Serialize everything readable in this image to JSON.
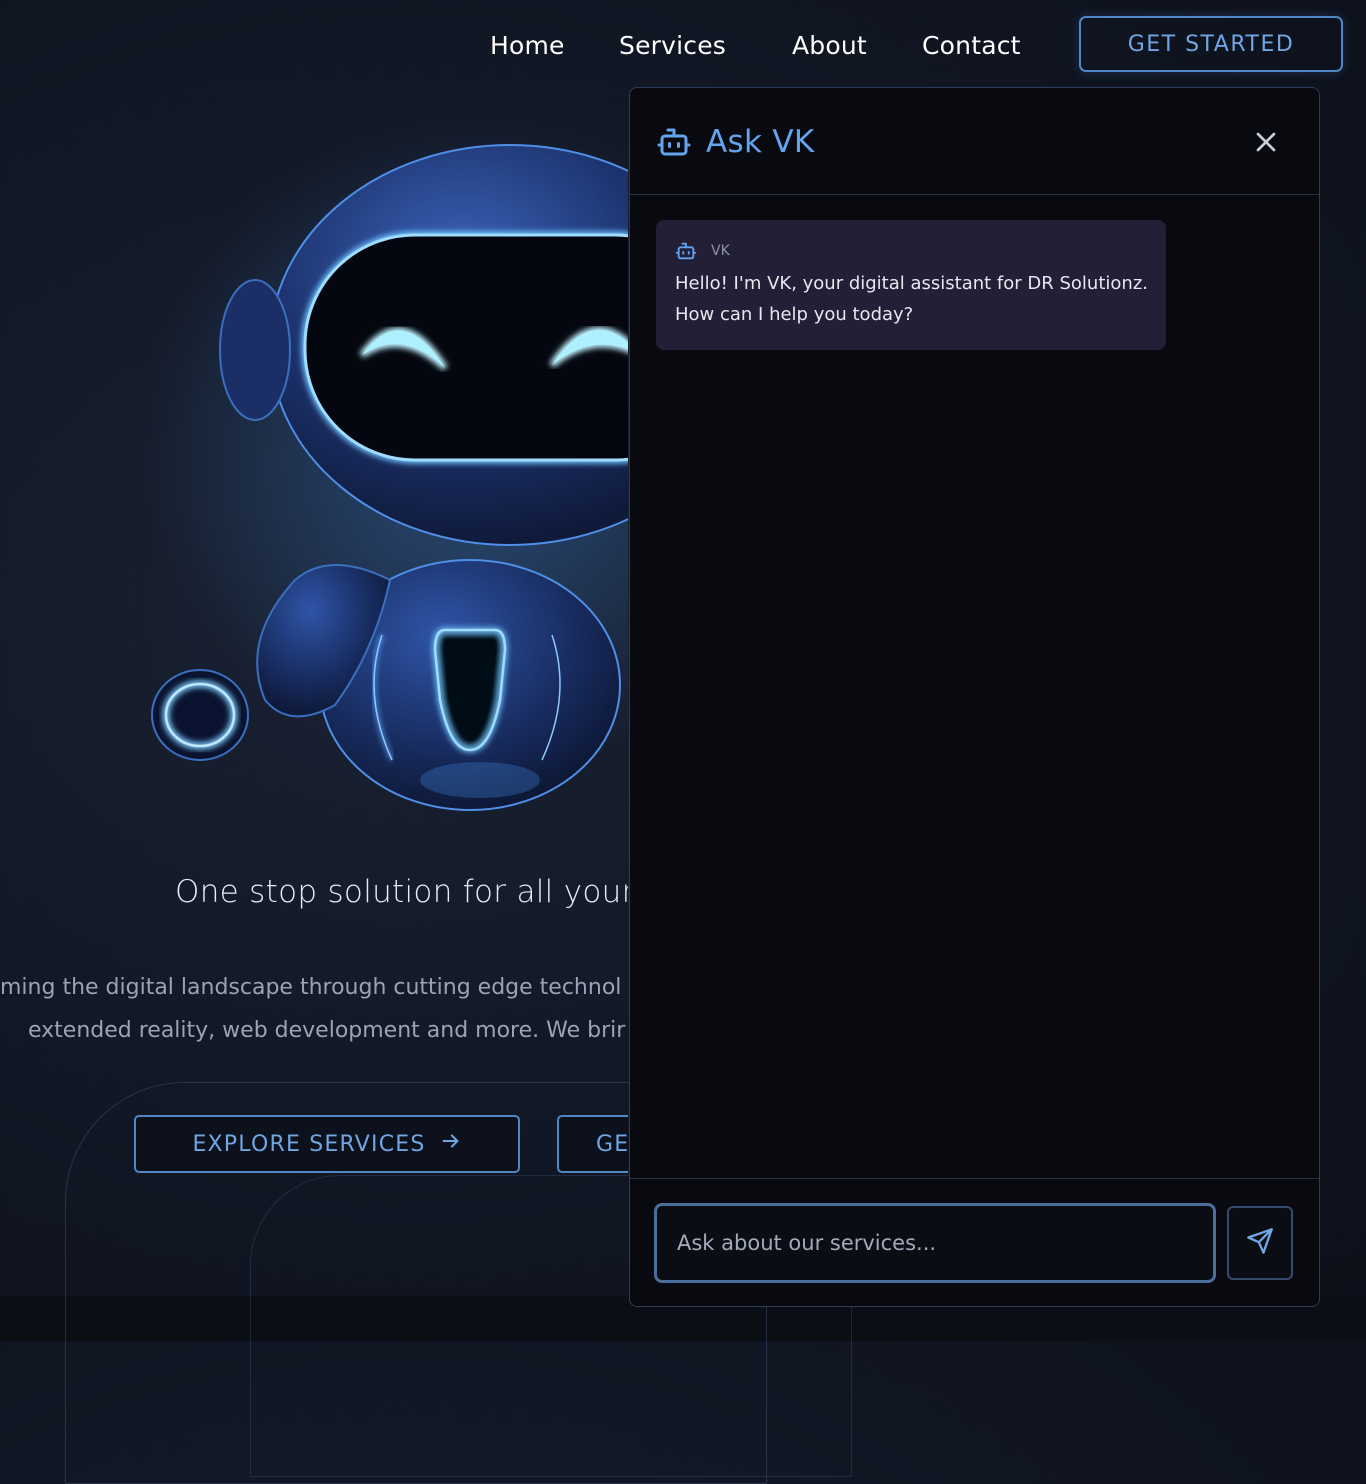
{
  "nav": {
    "links": [
      "Home",
      "Services",
      "About",
      "Contact"
    ],
    "cta_label": "GET STARTED"
  },
  "hero": {
    "headline": "One stop solution for all your D",
    "paragraph_line1": "ming the digital landscape through cutting edge technol",
    "paragraph_line2": "extended reality, web development and more. We brir",
    "explore_label": "EXPLORE SERVICES",
    "second_label": "GE"
  },
  "chat": {
    "title": "Ask VK",
    "message": {
      "sender": "VK",
      "line1": "Hello! I'm VK, your digital assistant for DR Solutionz.",
      "line2": "How can I help you today?"
    },
    "input_placeholder": "Ask about our services..."
  },
  "colors": {
    "accent": "#62a4ee",
    "button_border": "#4f87c4",
    "panel_bg": "#090a10",
    "bubble_bg": "#231f36",
    "page_bg": "#121826"
  },
  "icons": {
    "title_icon": "robot-icon",
    "close_icon": "close-icon",
    "send_icon": "send-icon",
    "explore_arrow": "arrow-right-icon"
  }
}
